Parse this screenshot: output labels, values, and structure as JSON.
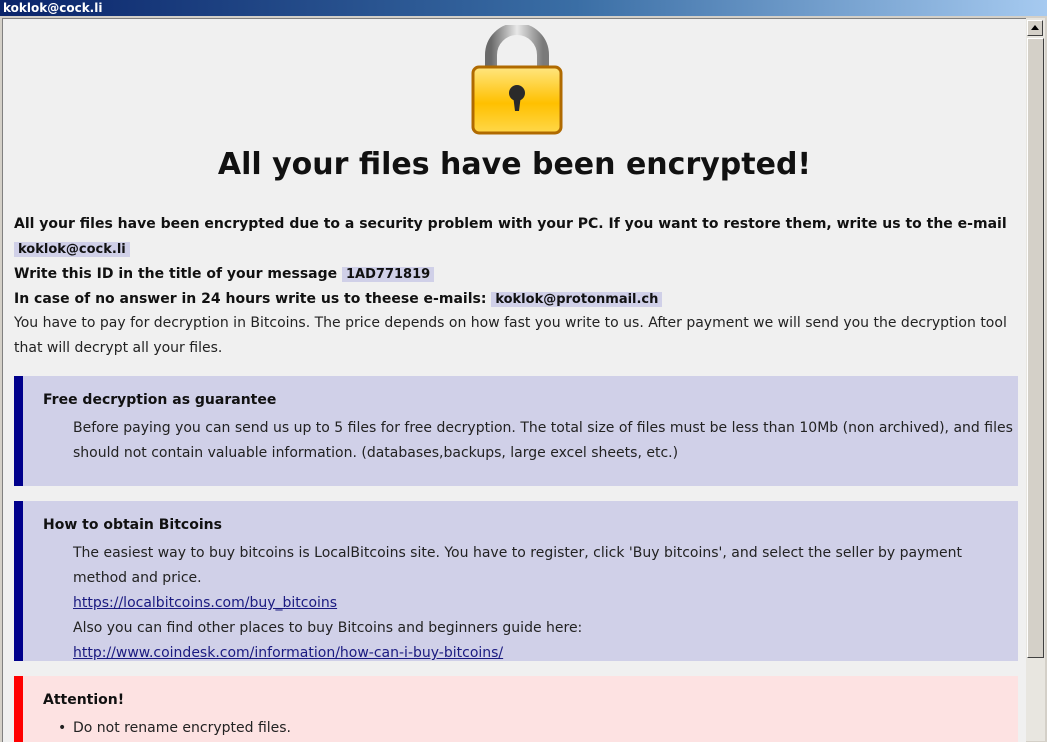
{
  "window": {
    "title": "koklok@cock.li"
  },
  "headline": "All your files have been encrypted!",
  "intro": {
    "text": "All your files have been encrypted due to a security problem with your PC. If you want to restore them, write us to the e-mail",
    "email": "koklok@cock.li",
    "id_label": "Write this ID in the title of your message",
    "id_value": "1AD771819",
    "alt_label": "In case of no answer in 24 hours write us to theese e-mails:",
    "alt_email": "koklok@protonmail.ch",
    "payment": "You have to pay for decryption in Bitcoins. The price depends on how fast you write to us. After payment we will send you the decryption tool that will decrypt all your files."
  },
  "guarantee": {
    "title": "Free decryption as guarantee",
    "text": "Before paying you can send us up to 5 files for free decryption. The total size of files must be less than 10Mb (non archived), and files should not contain valuable information. (databases,backups, large excel sheets, etc.)"
  },
  "bitcoins": {
    "title": "How to obtain Bitcoins",
    "text1": "The easiest way to buy bitcoins is LocalBitcoins site. You have to register, click 'Buy bitcoins', and select the seller by payment method and price.",
    "link1": "https://localbitcoins.com/buy_bitcoins",
    "text2": "Also you can find other places to buy Bitcoins and beginners guide here:",
    "link2": "http://www.coindesk.com/information/how-can-i-buy-bitcoins/"
  },
  "attention": {
    "title": "Attention!",
    "items": [
      "Do not rename encrypted files."
    ]
  },
  "icons": {
    "lock": "lock-icon",
    "scroll_up": "scroll-up-arrow-icon"
  },
  "colors": {
    "accent_blue": "#00008b",
    "accent_red": "#ff0000",
    "box_blue": "#d0d0e8",
    "box_red": "#fde2e2"
  }
}
